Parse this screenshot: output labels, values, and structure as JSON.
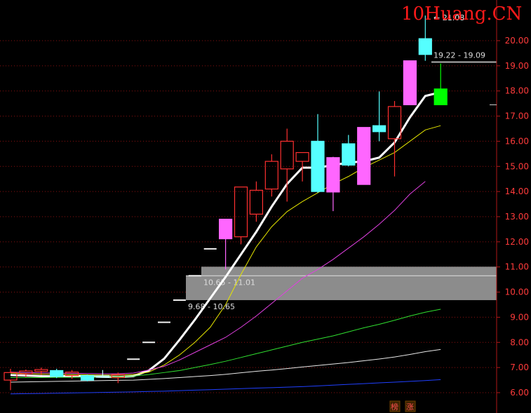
{
  "watermark": "10Huang.CN",
  "colors": {
    "background": "#000000",
    "grid": "#8a1010",
    "axis": "#b01818",
    "tick_text": "#ff3b3b",
    "up_hollow": "#ff3030",
    "up_filled": "#ff66ff",
    "down_filled": "#55ffff",
    "last_candle": "#00ff00",
    "zone_fill": "#8c8c8c",
    "ma_lines": [
      "#ffffff",
      "#e6e600",
      "#e040e0",
      "#30e030",
      "#e8e8e8",
      "#2040ff"
    ]
  },
  "chart_data": {
    "type": "candlestick",
    "title": "",
    "ylim": [
      5.9,
      21.5
    ],
    "yticks": [
      "6.00",
      "7.00",
      "8.00",
      "9.00",
      "10.00",
      "11.00",
      "12.00",
      "13.00",
      "14.00",
      "15.00",
      "16.00",
      "17.00",
      "18.00",
      "19.00",
      "20.00"
    ],
    "grid": true,
    "candles": [
      {
        "o": 6.5,
        "h": 6.95,
        "l": 6.1,
        "c": 6.8,
        "style": "up_hollow"
      },
      {
        "o": 6.75,
        "h": 6.92,
        "l": 6.62,
        "c": 6.86,
        "style": "up_hollow"
      },
      {
        "o": 6.85,
        "h": 7.0,
        "l": 6.7,
        "c": 6.92,
        "style": "up_hollow"
      },
      {
        "o": 6.88,
        "h": 6.95,
        "l": 6.58,
        "c": 6.65,
        "style": "down_filled"
      },
      {
        "o": 6.68,
        "h": 6.9,
        "l": 6.55,
        "c": 6.82,
        "style": "up_hollow"
      },
      {
        "o": 6.68,
        "h": 6.72,
        "l": 6.45,
        "c": 6.5,
        "style": "down_filled"
      },
      {
        "o": 6.63,
        "h": 6.9,
        "l": 6.6,
        "c": 6.67,
        "style": "doji"
      },
      {
        "o": 6.6,
        "h": 6.8,
        "l": 6.38,
        "c": 6.72,
        "style": "up_hollow"
      },
      {
        "o": 7.33,
        "h": 7.33,
        "l": 7.33,
        "c": 7.33,
        "style": "flat"
      },
      {
        "o": 8.0,
        "h": 8.0,
        "l": 8.0,
        "c": 8.0,
        "style": "flat"
      },
      {
        "o": 8.8,
        "h": 8.8,
        "l": 8.8,
        "c": 8.8,
        "style": "flat"
      },
      {
        "o": 9.68,
        "h": 9.68,
        "l": 9.68,
        "c": 9.68,
        "style": "flat"
      },
      {
        "o": 10.65,
        "h": 10.65,
        "l": 10.65,
        "c": 10.65,
        "style": "flat"
      },
      {
        "o": 11.72,
        "h": 11.72,
        "l": 11.72,
        "c": 11.72,
        "style": "flat"
      },
      {
        "o": 12.12,
        "h": 12.9,
        "l": 10.9,
        "c": 12.9,
        "style": "up_filled"
      },
      {
        "o": 12.2,
        "h": 14.18,
        "l": 11.9,
        "c": 14.18,
        "style": "up_hollow"
      },
      {
        "o": 13.1,
        "h": 14.4,
        "l": 12.8,
        "c": 14.05,
        "style": "up_hollow"
      },
      {
        "o": 14.1,
        "h": 15.48,
        "l": 13.8,
        "c": 15.2,
        "style": "up_hollow"
      },
      {
        "o": 14.9,
        "h": 16.5,
        "l": 13.6,
        "c": 16.0,
        "style": "up_hollow"
      },
      {
        "o": 15.2,
        "h": 15.55,
        "l": 14.4,
        "c": 15.55,
        "style": "up_hollow"
      },
      {
        "o": 16.0,
        "h": 17.08,
        "l": 13.95,
        "c": 14.0,
        "style": "down_filled"
      },
      {
        "o": 13.98,
        "h": 15.38,
        "l": 13.22,
        "c": 15.35,
        "style": "up_filled"
      },
      {
        "o": 15.9,
        "h": 16.25,
        "l": 15.0,
        "c": 15.05,
        "style": "down_filled"
      },
      {
        "o": 14.28,
        "h": 16.55,
        "l": 14.28,
        "c": 16.55,
        "style": "up_filled"
      },
      {
        "o": 16.62,
        "h": 17.98,
        "l": 16.0,
        "c": 16.38,
        "style": "down_filled"
      },
      {
        "o": 16.1,
        "h": 17.6,
        "l": 14.6,
        "c": 17.38,
        "style": "up_hollow"
      },
      {
        "o": 17.45,
        "h": 19.2,
        "l": 17.45,
        "c": 19.2,
        "style": "up_filled"
      },
      {
        "o": 20.08,
        "h": 21.0,
        "l": 19.2,
        "c": 19.45,
        "style": "down_filled"
      },
      {
        "o": 18.08,
        "h": 19.09,
        "l": 17.45,
        "c": 17.45,
        "style": "last_green"
      }
    ],
    "moving_averages": [
      {
        "color": "#ffffff",
        "values": [
          6.7,
          6.68,
          6.66,
          6.65,
          6.66,
          6.65,
          6.63,
          6.62,
          6.66,
          6.88,
          7.35,
          8.1,
          8.9,
          9.75,
          10.6,
          11.5,
          12.4,
          13.4,
          14.3,
          14.95,
          14.95,
          15.05,
          15.15,
          15.2,
          15.35,
          15.95,
          16.95,
          17.8,
          17.95
        ]
      },
      {
        "color": "#e6e600",
        "values": [
          6.78,
          6.76,
          6.74,
          6.73,
          6.72,
          6.71,
          6.7,
          6.7,
          6.72,
          6.82,
          7.1,
          7.5,
          8.0,
          8.6,
          9.5,
          10.7,
          11.8,
          12.6,
          13.2,
          13.6,
          13.95,
          14.3,
          14.6,
          14.95,
          15.25,
          15.55,
          16.0,
          16.45,
          16.62
        ]
      },
      {
        "color": "#e040e0",
        "values": [
          6.82,
          6.8,
          6.79,
          6.78,
          6.77,
          6.76,
          6.75,
          6.75,
          6.78,
          6.9,
          7.05,
          7.3,
          7.6,
          7.9,
          8.2,
          8.6,
          9.05,
          9.55,
          10.05,
          10.55,
          10.9,
          11.3,
          11.75,
          12.2,
          12.7,
          13.25,
          13.9,
          14.4
        ]
      },
      {
        "color": "#30e030",
        "values": [
          6.6,
          6.6,
          6.6,
          6.61,
          6.61,
          6.62,
          6.62,
          6.63,
          6.66,
          6.72,
          6.8,
          6.88,
          7.0,
          7.12,
          7.25,
          7.4,
          7.55,
          7.7,
          7.85,
          8.0,
          8.13,
          8.26,
          8.42,
          8.58,
          8.72,
          8.88,
          9.05,
          9.2,
          9.32
        ]
      },
      {
        "color": "#e8e8e8",
        "values": [
          6.42,
          6.43,
          6.44,
          6.45,
          6.46,
          6.47,
          6.48,
          6.49,
          6.5,
          6.53,
          6.56,
          6.6,
          6.64,
          6.68,
          6.73,
          6.79,
          6.85,
          6.9,
          6.96,
          7.02,
          7.08,
          7.14,
          7.2,
          7.27,
          7.34,
          7.42,
          7.52,
          7.63,
          7.72
        ]
      },
      {
        "color": "#2040ff",
        "values": [
          5.95,
          5.96,
          5.97,
          5.98,
          5.99,
          6.0,
          6.01,
          6.02,
          6.03,
          6.05,
          6.06,
          6.08,
          6.1,
          6.12,
          6.14,
          6.16,
          6.18,
          6.2,
          6.22,
          6.24,
          6.27,
          6.3,
          6.33,
          6.36,
          6.39,
          6.42,
          6.45,
          6.48,
          6.52
        ]
      }
    ],
    "zones": [
      {
        "low": 10.65,
        "high": 11.01,
        "label": "10.65 - 11.01"
      },
      {
        "low": 9.68,
        "high": 10.65,
        "label": "9.68 - 10.65"
      }
    ],
    "range_marker": {
      "value": 19.15,
      "label": "19.22 - 19.09"
    },
    "peak_label": "21.08",
    "bottom_badges": [
      "榜",
      "涨"
    ]
  }
}
